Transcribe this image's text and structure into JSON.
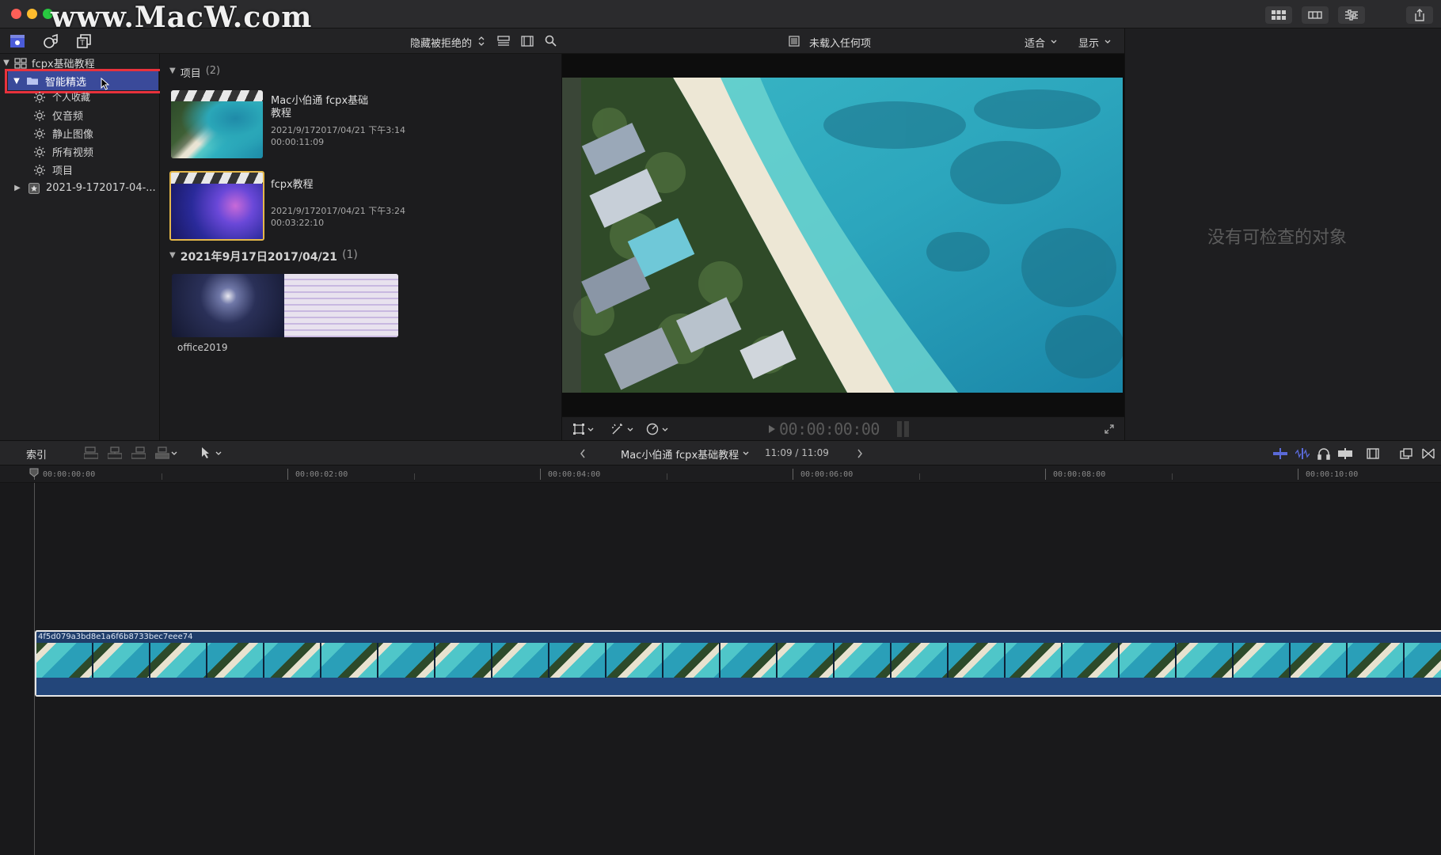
{
  "watermark": "www.MacW.com",
  "library_toolbar": {
    "filter_label": "隐藏被拒绝的"
  },
  "libraries": {
    "library_name": "fcpx基础教程",
    "selected_item": "智能精选",
    "items": [
      {
        "label": "个人收藏"
      },
      {
        "label": "仅音频"
      },
      {
        "label": "静止图像"
      },
      {
        "label": "所有视频"
      },
      {
        "label": "项目"
      }
    ],
    "event_name": "2021-9-172017-04-..."
  },
  "browser": {
    "section1_title": "项目",
    "section1_count": "(2)",
    "projects": [
      {
        "title": "Mac小伯通 fcpx基础",
        "title2": "教程",
        "date": "2021/9/172017/04/21 下午3:14",
        "duration": "00:00:11:09"
      },
      {
        "title": "fcpx教程",
        "title2": "",
        "date": "2021/9/172017/04/21 下午3:24",
        "duration": "00:03:22:10"
      }
    ],
    "section2_title": "2021年9月17日2017/04/21",
    "section2_count": "(1)",
    "event_clip": "office2019"
  },
  "viewer": {
    "title": "未载入任何项",
    "fit_label": "适合",
    "display_label": "显示",
    "timecode": "00:00:00:00"
  },
  "inspector": {
    "empty_message": "没有可检查的对象"
  },
  "timeline": {
    "index_label": "索引",
    "project_name": "Mac小伯通 fcpx基础教程",
    "duration": "11:09 / 11:09",
    "clip_name": "4f5d079a3bd8e1a6f6b8733bec7eee74",
    "ruler": [
      {
        "label": "00:00:00:00"
      },
      {
        "label": "00:00:02:00"
      },
      {
        "label": "00:00:04:00"
      },
      {
        "label": "00:00:06:00"
      },
      {
        "label": "00:00:08:00"
      },
      {
        "label": "00:00:10:00"
      }
    ]
  },
  "colors": {
    "selection": "#3a4a9a",
    "highlight_box": "#e8323c",
    "clip_border": "#3a67a8",
    "accent": "#4a5bd8"
  }
}
